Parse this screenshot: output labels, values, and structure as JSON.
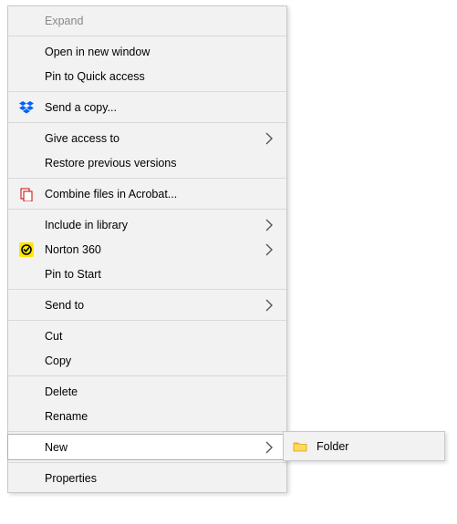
{
  "context_menu": {
    "expand": "Expand",
    "open_new_window": "Open in new window",
    "pin_quick": "Pin to Quick access",
    "send_copy": "Send a copy...",
    "give_access": "Give access to",
    "restore_versions": "Restore previous versions",
    "combine_acrobat": "Combine files in Acrobat...",
    "include_library": "Include in library",
    "norton": "Norton 360",
    "pin_start": "Pin to Start",
    "send_to": "Send to",
    "cut": "Cut",
    "copy": "Copy",
    "delete": "Delete",
    "rename": "Rename",
    "new": "New",
    "properties": "Properties"
  },
  "submenu": {
    "folder": "Folder"
  },
  "icons": {
    "dropbox": "dropbox-icon",
    "acrobat": "acrobat-icon",
    "norton": "norton-icon",
    "folder": "folder-icon",
    "chevron": "chevron-right-icon"
  }
}
